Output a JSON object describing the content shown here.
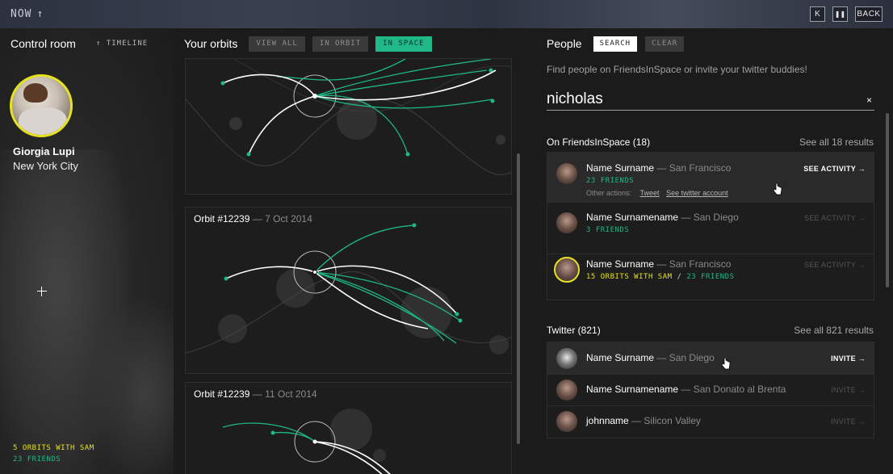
{
  "topbar": {
    "now_label": "NOW",
    "now_arrow": "↑",
    "icon_collapse": "K",
    "icon_pause": "❚❚",
    "back_label": "BACK"
  },
  "control_room": {
    "title": "Control room",
    "timeline_label": "↑ TIMELINE",
    "user_name": "Giorgia Lupi",
    "user_city": "New York City",
    "stats_orbits": "5 ORBITS WITH SAM",
    "stats_friends": "23 FRIENDS",
    "accent_yellow": "#e6e21e",
    "accent_green": "#1fb886"
  },
  "orbits": {
    "title": "Your orbits",
    "filters": [
      "VIEW ALL",
      "IN ORBIT",
      "IN SPACE"
    ],
    "active_filter": "IN SPACE",
    "cards": [
      {
        "label": "",
        "date": ""
      },
      {
        "label": "Orbit #12239",
        "date": "— 7 Oct 2014"
      },
      {
        "label": "Orbit #12239",
        "date": "— 11 Oct 2014"
      }
    ]
  },
  "people": {
    "title": "People",
    "search_button": "SEARCH",
    "clear_button": "CLEAR",
    "hint": "Find people on FriendsInSpace or invite your twitter buddies!",
    "query": "nicholas",
    "clear_icon": "×",
    "fis": {
      "heading": "On FriendsInSpace (18)",
      "see_all": "See all 18 results",
      "results": [
        {
          "name": "Name Surname",
          "city": "— San Francisco",
          "stat1": "23 FRIENDS",
          "stat2": "",
          "action": "SEE ACTIVITY →",
          "other_label": "Other actions:",
          "link1": "Tweet",
          "link2": "See twitter account"
        },
        {
          "name": "Name Surnamename",
          "city": "— San Diego",
          "stat1": "3 FRIENDS",
          "stat2": "",
          "action": "SEE ACTIVITY →"
        },
        {
          "name": "Name Surname",
          "city": "— San Francisco",
          "stat1": "15 ORBITS WITH SAM",
          "sep": "/",
          "stat2": "23 FRIENDS",
          "action": "SEE ACTIVITY →"
        }
      ]
    },
    "twitter": {
      "heading": "Twitter (821)",
      "see_all": "See all 821 results",
      "results": [
        {
          "name": "Name Surname",
          "city": "— San Diego",
          "action": "INVITE →"
        },
        {
          "name": "Name Surnamename",
          "city": "— San Donato al Brenta",
          "action": "INVITE →"
        },
        {
          "name": "johnname",
          "city": "— Silicon Valley",
          "action": "INVITE →"
        }
      ]
    }
  }
}
